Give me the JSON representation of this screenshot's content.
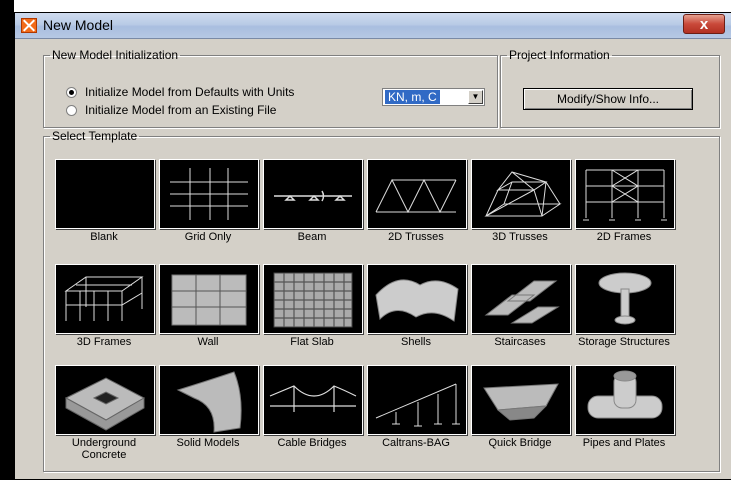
{
  "window": {
    "title": "New Model",
    "close_label": "x"
  },
  "init": {
    "legend": "New Model Initialization",
    "opt1": "Initialize Model from Defaults with Units",
    "opt2": "Initialize Model  from an Existing File",
    "units": "KN, m, C"
  },
  "project": {
    "legend": "Project Information",
    "button": "Modify/Show Info..."
  },
  "templates": {
    "legend": "Select Template",
    "items": [
      {
        "label": "Blank"
      },
      {
        "label": "Grid Only"
      },
      {
        "label": "Beam"
      },
      {
        "label": "2D Trusses"
      },
      {
        "label": "3D Trusses"
      },
      {
        "label": "2D Frames"
      },
      {
        "label": "3D Frames"
      },
      {
        "label": "Wall"
      },
      {
        "label": "Flat Slab"
      },
      {
        "label": "Shells"
      },
      {
        "label": "Staircases"
      },
      {
        "label": "Storage Structures"
      },
      {
        "label": "Underground Concrete"
      },
      {
        "label": "Solid Models"
      },
      {
        "label": "Cable Bridges"
      },
      {
        "label": "Caltrans-BAG"
      },
      {
        "label": "Quick Bridge"
      },
      {
        "label": "Pipes and Plates"
      }
    ]
  },
  "colors": {
    "title_bar": "#b9cbe6",
    "dialog": "#d4d0c8",
    "selection": "#316ac5",
    "close": "#c9493a"
  }
}
